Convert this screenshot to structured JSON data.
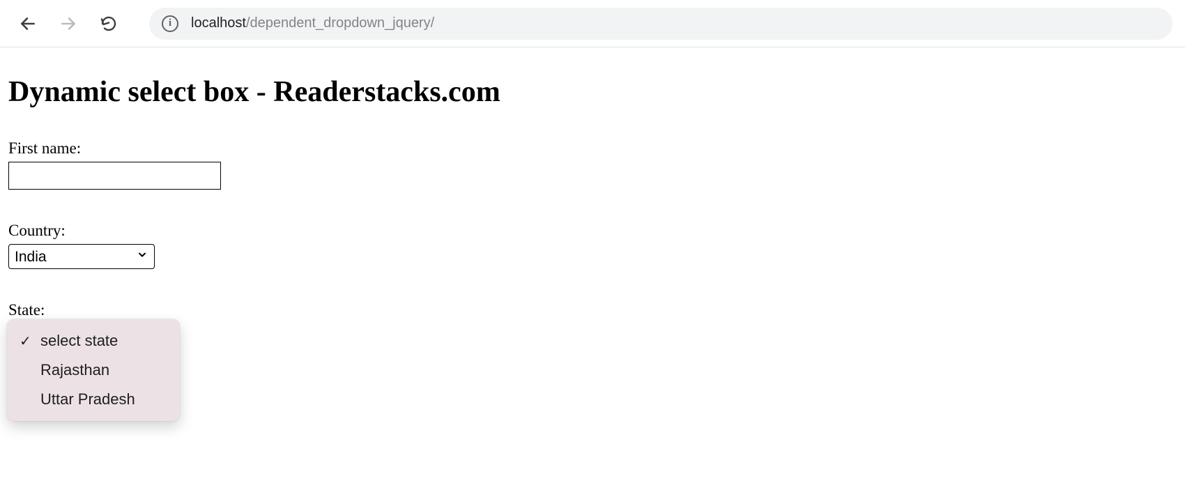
{
  "browser": {
    "url_host": "localhost",
    "url_path": "/dependent_dropdown_jquery/"
  },
  "page": {
    "title": "Dynamic select box - Readerstacks.com",
    "first_name": {
      "label": "First name:",
      "value": ""
    },
    "country": {
      "label": "Country:",
      "selected": "India"
    },
    "state": {
      "label": "State:",
      "options": [
        {
          "label": "select state",
          "checked": true
        },
        {
          "label": "Rajasthan",
          "checked": false
        },
        {
          "label": "Uttar Pradesh",
          "checked": false
        }
      ]
    }
  },
  "glyphs": {
    "check": "✓"
  }
}
